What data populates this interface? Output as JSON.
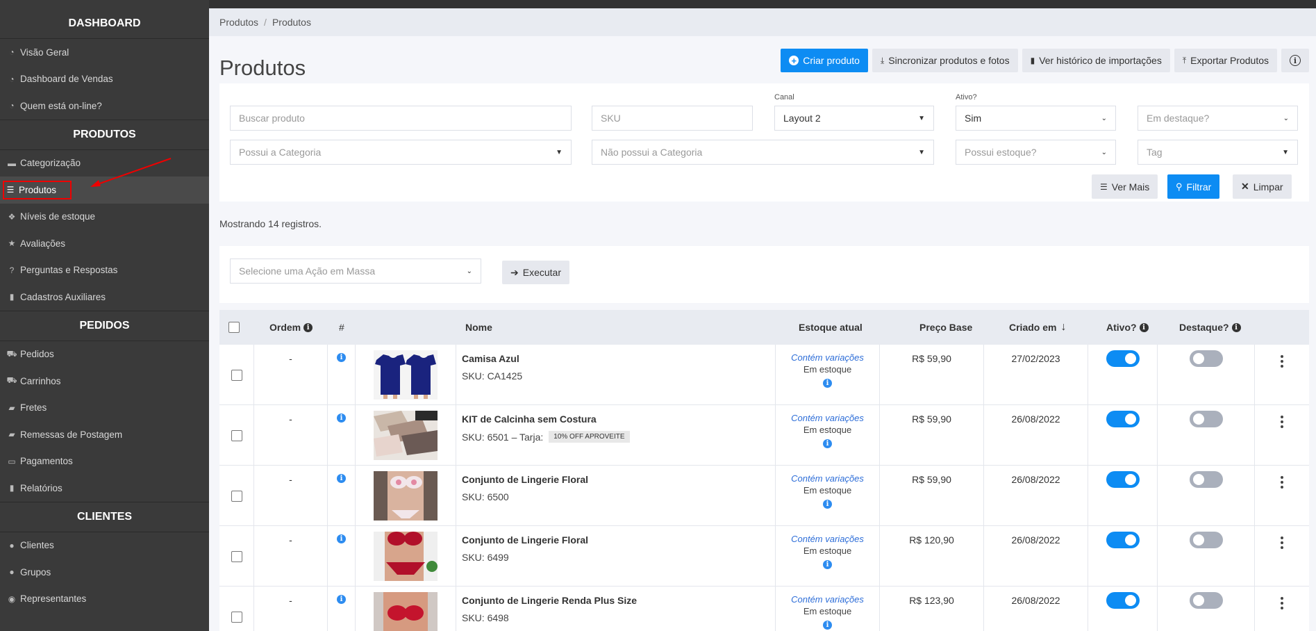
{
  "sidebar": {
    "sections": [
      {
        "title": "DASHBOARD",
        "items": [
          {
            "label": "Visão Geral",
            "icon": "dashboard-icon"
          },
          {
            "label": "Dashboard de Vendas",
            "icon": "dashboard-icon"
          },
          {
            "label": "Quem está on-line?",
            "icon": "dashboard-icon"
          }
        ]
      },
      {
        "title": "PRODUTOS",
        "items": [
          {
            "label": "Categorização",
            "icon": "folder-icon"
          },
          {
            "label": "Produtos",
            "icon": "list-icon",
            "active": true
          },
          {
            "label": "Níveis de estoque",
            "icon": "cubes-icon"
          },
          {
            "label": "Avaliações",
            "icon": "star-icon"
          },
          {
            "label": "Perguntas e Respostas",
            "icon": "question-icon"
          },
          {
            "label": "Cadastros Auxiliares",
            "icon": "file-icon"
          }
        ]
      },
      {
        "title": "PEDIDOS",
        "items": [
          {
            "label": "Pedidos",
            "icon": "cart-icon"
          },
          {
            "label": "Carrinhos",
            "icon": "cart-icon"
          },
          {
            "label": "Fretes",
            "icon": "truck-icon"
          },
          {
            "label": "Remessas de Postagem",
            "icon": "truck-icon"
          },
          {
            "label": "Pagamentos",
            "icon": "credit-card-icon"
          },
          {
            "label": "Relatórios",
            "icon": "bar-chart-icon"
          }
        ]
      },
      {
        "title": "CLIENTES",
        "items": [
          {
            "label": "Clientes",
            "icon": "user-icon"
          },
          {
            "label": "Grupos",
            "icon": "users-icon"
          },
          {
            "label": "Representantes",
            "icon": "user-circle-icon"
          }
        ]
      }
    ]
  },
  "breadcrumb": {
    "first": "Produtos",
    "second": "Produtos"
  },
  "page": {
    "title": "Produtos"
  },
  "actions": {
    "create": "Criar produto",
    "sync": "Sincronizar produtos e fotos",
    "history": "Ver histórico de importações",
    "export": "Exportar Produtos"
  },
  "filters": {
    "search_placeholder": "Buscar produto",
    "sku_placeholder": "SKU",
    "canal_label": "Canal",
    "canal_value": "Layout 2",
    "ativo_label": "Ativo?",
    "ativo_value": "Sim",
    "destaque_placeholder": "Em destaque?",
    "has_category_placeholder": "Possui a Categoria",
    "not_category_placeholder": "Não possui a Categoria",
    "stock_placeholder": "Possui estoque?",
    "tag_placeholder": "Tag",
    "ver_mais": "Ver Mais",
    "filtrar": "Filtrar",
    "limpar": "Limpar"
  },
  "showing": "Mostrando 14 registros.",
  "mass_action": {
    "placeholder": "Selecione uma Ação em Massa",
    "execute": "Executar"
  },
  "table": {
    "headers": {
      "ordem": "Ordem",
      "hash": "#",
      "nome": "Nome",
      "estoque": "Estoque atual",
      "preco": "Preço Base",
      "criado": "Criado em",
      "ativo": "Ativo?",
      "destaque": "Destaque?"
    },
    "rows": [
      {
        "ordem": "-",
        "name": "Camisa Azul",
        "sku": "SKU: CA1425",
        "tag": "",
        "variations": "Contém variações",
        "stock": "Em estoque",
        "price": "R$ 59,90",
        "created": "27/02/2023",
        "active": true,
        "featured": false
      },
      {
        "ordem": "-",
        "name": "KIT de Calcinha sem Costura",
        "sku": "SKU: 6501 – Tarja:",
        "tag": "10% OFF APROVEITE",
        "variations": "Contém variações",
        "stock": "Em estoque",
        "price": "R$ 59,90",
        "created": "26/08/2022",
        "active": true,
        "featured": false
      },
      {
        "ordem": "-",
        "name": "Conjunto de Lingerie Floral",
        "sku": "SKU: 6500",
        "tag": "",
        "variations": "Contém variações",
        "stock": "Em estoque",
        "price": "R$ 59,90",
        "created": "26/08/2022",
        "active": true,
        "featured": false
      },
      {
        "ordem": "-",
        "name": "Conjunto de Lingerie Floral",
        "sku": "SKU: 6499",
        "tag": "",
        "variations": "Contém variações",
        "stock": "Em estoque",
        "price": "R$ 120,90",
        "created": "26/08/2022",
        "active": true,
        "featured": false
      },
      {
        "ordem": "-",
        "name": "Conjunto de Lingerie Renda Plus Size",
        "sku": "SKU: 6498",
        "tag": "",
        "variations": "Contém variações",
        "stock": "Em estoque",
        "price": "R$ 123,90",
        "created": "26/08/2022",
        "active": true,
        "featured": false
      }
    ]
  },
  "colors": {
    "primary": "#0d8cf3",
    "sidebar_bg": "#3a3a3a",
    "highlight": "#e00000"
  }
}
